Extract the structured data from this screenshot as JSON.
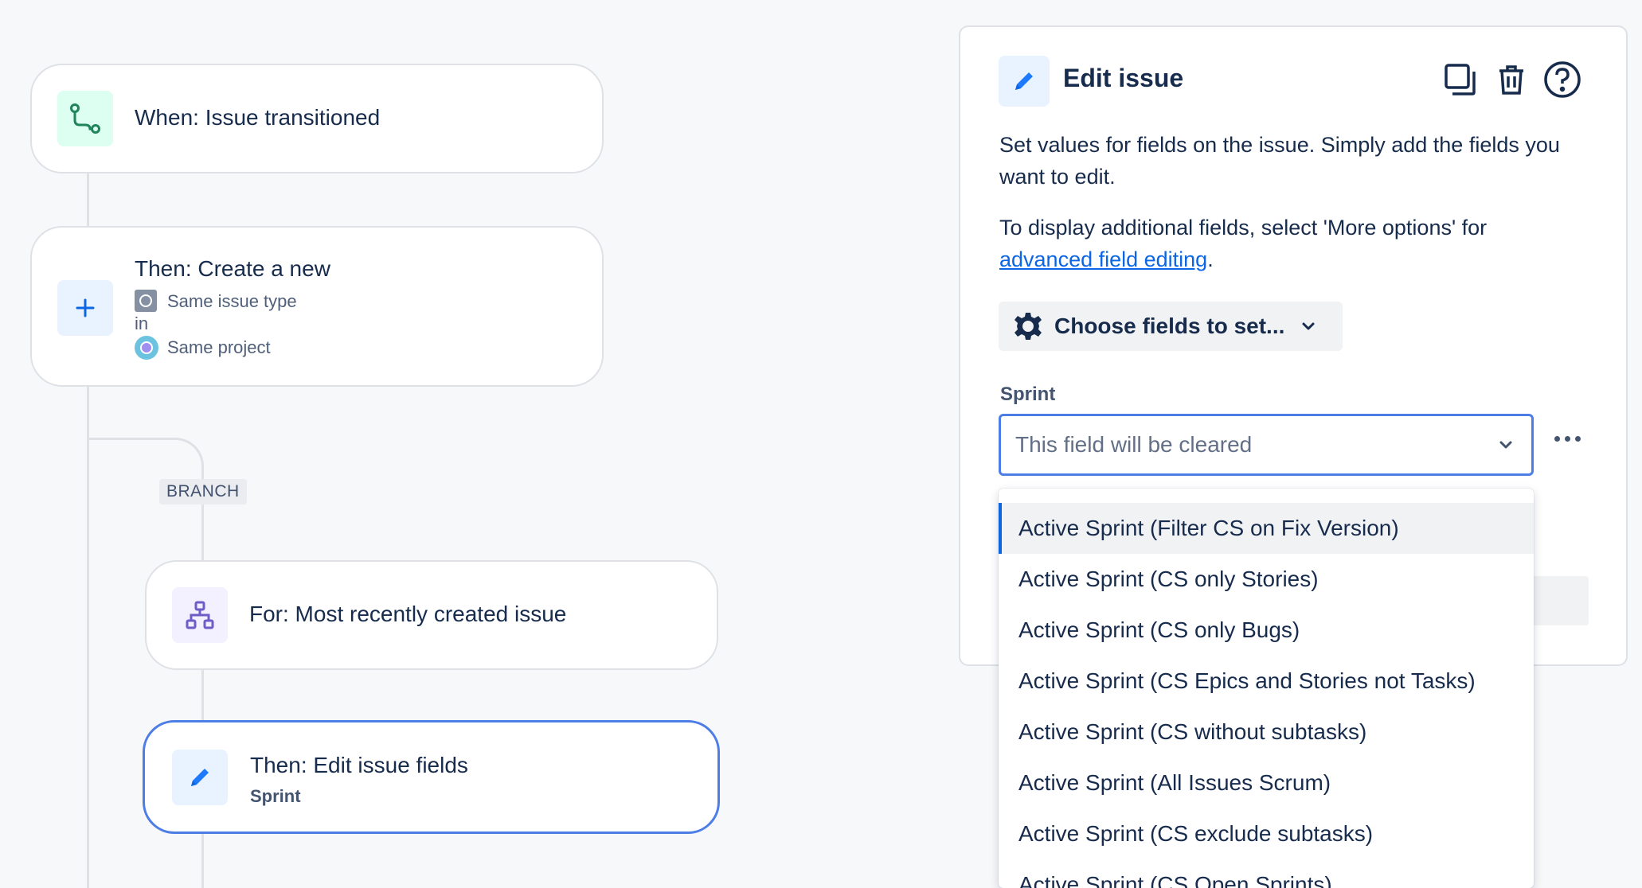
{
  "flow": {
    "trigger": {
      "title": "When: Issue transitioned",
      "icon": "transition-icon"
    },
    "create": {
      "title": "Then: Create a new",
      "issue_type": "Same issue type",
      "in_label": "in",
      "project": "Same project",
      "icon": "plus-icon"
    },
    "branch_label": "BRANCH",
    "for_each": {
      "title": "For: Most recently created issue",
      "icon": "hierarchy-icon"
    },
    "edit": {
      "title": "Then: Edit issue fields",
      "subtitle": "Sprint",
      "icon": "pencil-icon"
    }
  },
  "panel": {
    "title": "Edit issue",
    "description": "Set values for fields on the issue. Simply add the fields you want to edit.",
    "more_text": "To display additional fields, select 'More options' for",
    "link_text": "advanced field editing",
    "link_suffix": ".",
    "choose_fields_label": "Choose fields to set...",
    "field_label": "Sprint",
    "select_placeholder": "This field will be cleared",
    "tools": [
      "duplicate-icon",
      "trash-icon",
      "help-icon"
    ]
  },
  "dropdown": {
    "options": [
      "Active Sprint (Filter CS on Fix Version)",
      "Active Sprint (CS only Stories)",
      "Active Sprint (CS only Bugs)",
      "Active Sprint (CS Epics and Stories not Tasks)",
      "Active Sprint (CS without subtasks)",
      "Active Sprint (All Issues Scrum)",
      "Active Sprint (CS exclude subtasks)",
      "Active Sprint (CS Open Sprints)"
    ],
    "highlighted_index": 0
  },
  "colors": {
    "accent": "#0c66e4",
    "selected_border": "#4c7ee6",
    "trigger_tile": "#dcfff1",
    "action_tile": "#e9f2ff",
    "branch_tile": "#f3f0ff"
  }
}
